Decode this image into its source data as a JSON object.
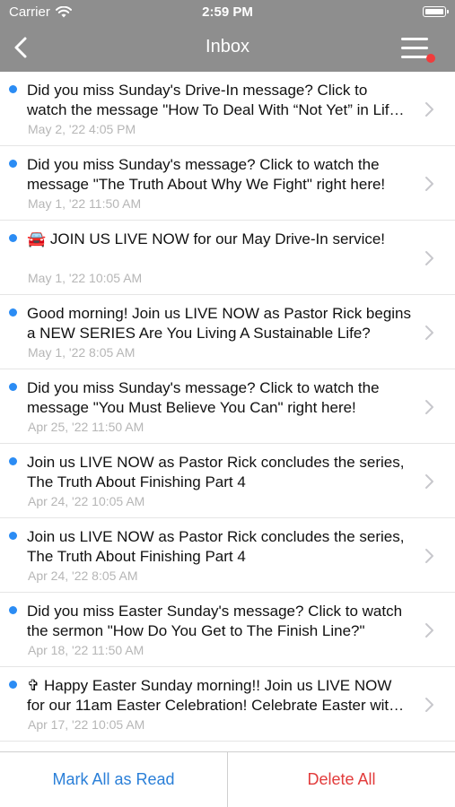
{
  "status_bar": {
    "carrier": "Carrier",
    "time": "2:59 PM"
  },
  "nav": {
    "title": "Inbox"
  },
  "messages": [
    {
      "text": "Did you miss Sunday's Drive-In message? Click to watch the message \"How To Deal With “Not Yet” in Life\" right here!",
      "date": "May 2, '22 4:05 PM"
    },
    {
      "text": "Did you miss Sunday's message? Click to watch the message \"The Truth About Why We Fight\" right here!",
      "date": "May 1, '22 11:50 AM"
    },
    {
      "text": "🚘 JOIN US LIVE NOW for our May Drive-In service!",
      "date": "May 1, '22 10:05 AM"
    },
    {
      "text": "Good morning! Join us LIVE NOW as Pastor Rick begins a NEW SERIES Are You Living A Sustainable Life?",
      "date": "May 1, '22 8:05 AM"
    },
    {
      "text": "Did you miss Sunday's message? Click to watch the message \"You Must Believe You Can\" right here!",
      "date": "Apr 25, '22 11:50 AM"
    },
    {
      "text": "Join us LIVE NOW as Pastor Rick concludes the series, The Truth About Finishing Part 4",
      "date": "Apr 24, '22 10:05 AM"
    },
    {
      "text": "Join us LIVE NOW as Pastor Rick concludes the series, The Truth About Finishing Part 4",
      "date": "Apr 24, '22 8:05 AM"
    },
    {
      "text": "Did you miss Easter Sunday's message? Click to watch the sermon \"How Do You Get to The Finish Line?\"",
      "date": "Apr 18, '22 11:50 AM"
    },
    {
      "text": "✞ Happy Easter Sunday morning!! Join us LIVE NOW for our 11am Easter Celebration! Celebrate Easter with us!",
      "date": "Apr 17, '22 10:05 AM"
    }
  ],
  "footer": {
    "mark_all_label": "Mark All as Read",
    "delete_all_label": "Delete All"
  },
  "colors": {
    "bar": "#8e8e8e",
    "unread_dot": "#2b8cf4",
    "link_blue": "#2a7fd8",
    "danger_red": "#e23b3b",
    "badge_red": "#f03c3c"
  }
}
